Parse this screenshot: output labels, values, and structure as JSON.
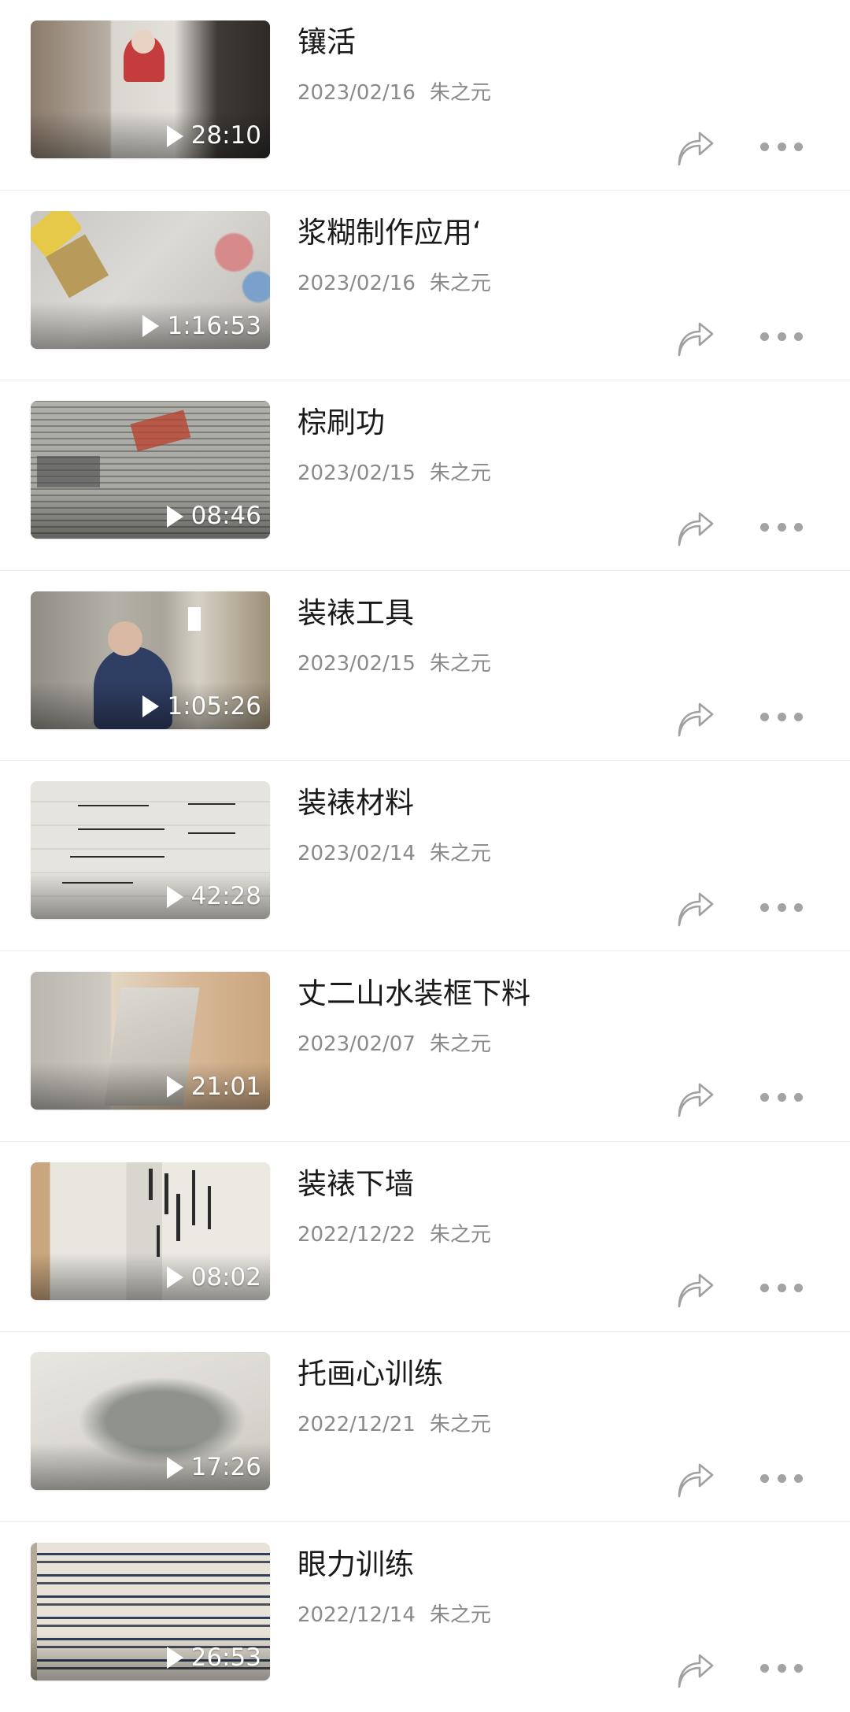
{
  "videos": [
    {
      "title": "镶活",
      "date": "2023/02/16",
      "author": "朱之元",
      "duration": "28:10"
    },
    {
      "title": "浆糊制作应用‘",
      "date": "2023/02/16",
      "author": "朱之元",
      "duration": "1:16:53"
    },
    {
      "title": "棕刷功",
      "date": "2023/02/15",
      "author": "朱之元",
      "duration": "08:46"
    },
    {
      "title": "装裱工具",
      "date": "2023/02/15",
      "author": "朱之元",
      "duration": "1:05:26"
    },
    {
      "title": "装裱材料",
      "date": "2023/02/14",
      "author": "朱之元",
      "duration": "42:28"
    },
    {
      "title": "丈二山水装框下料",
      "date": "2023/02/07",
      "author": "朱之元",
      "duration": "21:01"
    },
    {
      "title": "装裱下墙",
      "date": "2022/12/22",
      "author": "朱之元",
      "duration": "08:02"
    },
    {
      "title": "托画心训练",
      "date": "2022/12/21",
      "author": "朱之元",
      "duration": "17:26"
    },
    {
      "title": "眼力训练",
      "date": "2022/12/14",
      "author": "朱之元",
      "duration": "26:53"
    }
  ],
  "icons": {
    "share": "share-arrow-icon",
    "more": "more-dots-icon",
    "play": "play-icon"
  }
}
